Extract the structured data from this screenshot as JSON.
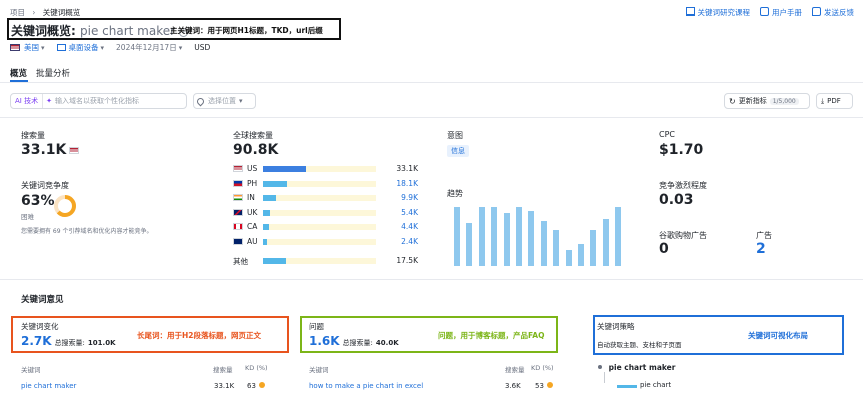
{
  "breadcrumb": {
    "root": "项目",
    "sep": "›",
    "current": "关键词概览"
  },
  "top_links": [
    {
      "label": "关键词研究课程",
      "icon": "graduation-cap-icon"
    },
    {
      "label": "用户手册",
      "icon": "book-icon"
    },
    {
      "label": "发送反馈",
      "icon": "feedback-icon"
    }
  ],
  "header": {
    "title_prefix": "关键词概览:",
    "keyword": "pie chart maker",
    "annotation": "主关键词：用于网页H1标题，TKD，url后缀"
  },
  "filters": {
    "country": "美国",
    "device": "桌面设备",
    "date": "2024年12月17日",
    "currency": "USD"
  },
  "tabs": [
    {
      "label": "概览",
      "active": true
    },
    {
      "label": "批量分析",
      "active": false
    }
  ],
  "search": {
    "ai_badge": "AI 技术",
    "placeholder": "输入域名以获取个性化指标",
    "location_placeholder": "选择位置"
  },
  "actions": {
    "refresh_label": "更新指标",
    "refresh_quota": "1/5,000",
    "pdf_label": "PDF"
  },
  "volume": {
    "label": "搜索量",
    "value": "33.1K"
  },
  "difficulty": {
    "label": "关键词竞争度",
    "value": "63%",
    "level": "困难",
    "percent": 63,
    "note": "您需要拥有 69 个引荐域名和优化内容才能竞争。"
  },
  "global": {
    "label": "全球搜索量",
    "value": "90.8K",
    "countries": [
      {
        "code": "US",
        "value": "33.1K",
        "share": 0.36
      },
      {
        "code": "PH",
        "value": "18.1K",
        "share": 0.2
      },
      {
        "code": "IN",
        "value": "9.9K",
        "share": 0.11
      },
      {
        "code": "UK",
        "value": "5.4K",
        "share": 0.06
      },
      {
        "code": "CA",
        "value": "4.4K",
        "share": 0.05
      },
      {
        "code": "AU",
        "value": "2.4K",
        "share": 0.03
      }
    ],
    "other": {
      "label": "其他",
      "value": "17.5K",
      "share": 0.19
    }
  },
  "intent": {
    "label": "意图",
    "value": "信息"
  },
  "trend": {
    "label": "趋势",
    "values": [
      0.95,
      0.7,
      0.95,
      0.95,
      0.85,
      0.95,
      0.88,
      0.72,
      0.58,
      0.25,
      0.35,
      0.58,
      0.75,
      0.95
    ]
  },
  "cpc": {
    "label": "CPC",
    "value": "$1.70"
  },
  "competition": {
    "label": "竞争激烈程度",
    "value": "0.03"
  },
  "shopping": {
    "label": "谷歌购物广告",
    "value": "0"
  },
  "ads": {
    "label": "广告",
    "value": "2"
  },
  "ideas": {
    "section_title": "关键词意见",
    "variations": {
      "title": "关键词变化",
      "count": "2.7K",
      "volume_label": "总搜索量:",
      "volume": "101.0K",
      "annotation": "长尾词：用于H2段落标题，网页正文",
      "col_keyword": "关键词",
      "col_volume": "搜索量",
      "col_kd": "KD (%)",
      "row": {
        "keyword": "pie chart maker",
        "volume": "33.1K",
        "kd": "63"
      },
      "color": "#e8541e"
    },
    "questions": {
      "title": "问题",
      "count": "1.6K",
      "volume_label": "总搜索量:",
      "volume": "40.0K",
      "annotation": "问题，用于博客标题，产品FAQ",
      "col_keyword": "关键词",
      "col_volume": "搜索量",
      "col_kd": "KD (%)",
      "row": {
        "keyword": "how to make a pie chart in excel",
        "volume": "3.6K",
        "kd": "53"
      },
      "color": "#7cb518"
    },
    "strategy": {
      "title": "关键词策略",
      "subtitle": "自动获取主题、支柱和子页面",
      "annotation": "关键词可视化布局",
      "root": "pie chart maker",
      "child": "pie chart",
      "color": "#1f6fd8"
    }
  }
}
